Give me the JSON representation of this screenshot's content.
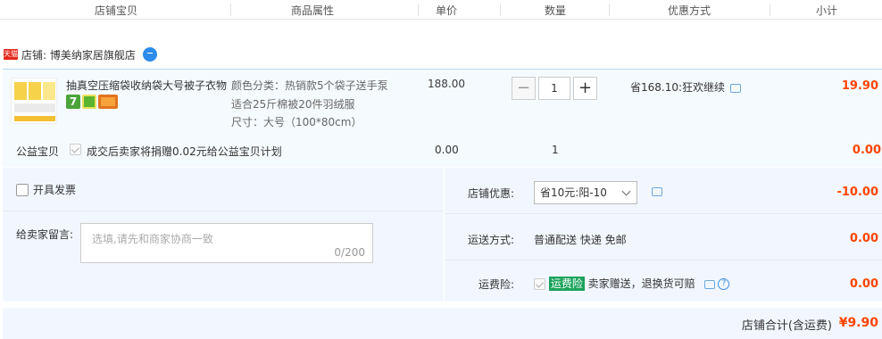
{
  "header": {
    "columns": [
      "店铺宝贝",
      "商品属性",
      "单价",
      "数量",
      "优惠方式",
      "小计"
    ]
  },
  "shop": {
    "badge": "天猫",
    "label": "店铺: 博美纳家居旗舰店"
  },
  "item": {
    "title": "抽真空压缩袋收纳袋大号被子衣物",
    "attr_line1": "颜色分类：热销款5个袋子送手泵",
    "attr_line2": "适合25斤棉被20件羽绒服",
    "attr_line3": "尺寸：大号（100*80cm）",
    "price": "188.00",
    "quantity": "1",
    "minus": "−",
    "plus": "+",
    "discount": "省168.10:狂欢继续",
    "subtotal": "19.90",
    "badge7": "7"
  },
  "charity": {
    "label": "公益宝贝",
    "text": "成交后卖家将捐赠0.02元给公益宝贝计划",
    "price": "0.00",
    "quantity": "1",
    "subtotal": "0.00"
  },
  "invoice": {
    "label": "开具发票"
  },
  "message": {
    "label": "给卖家留言:",
    "placeholder": "选填,请先和商家协商一致",
    "counter": "0/200"
  },
  "shop_discount": {
    "label": "店铺优惠:",
    "selected": "省10元:阳-10",
    "amount": "-10.00"
  },
  "shipping": {
    "label": "运送方式:",
    "value": "普通配送 快递 免邮",
    "amount": "0.00"
  },
  "insurance": {
    "label": "运费险:",
    "tag": "运费险",
    "text": "卖家赠送，退换货可赔",
    "amount": "0.00"
  },
  "total": {
    "label": "店铺合计(含运费)",
    "value": "¥9.90"
  },
  "colors": {
    "accent": "#ff4400",
    "panel": "#f2f7ff",
    "tmall": "#e5291c"
  }
}
